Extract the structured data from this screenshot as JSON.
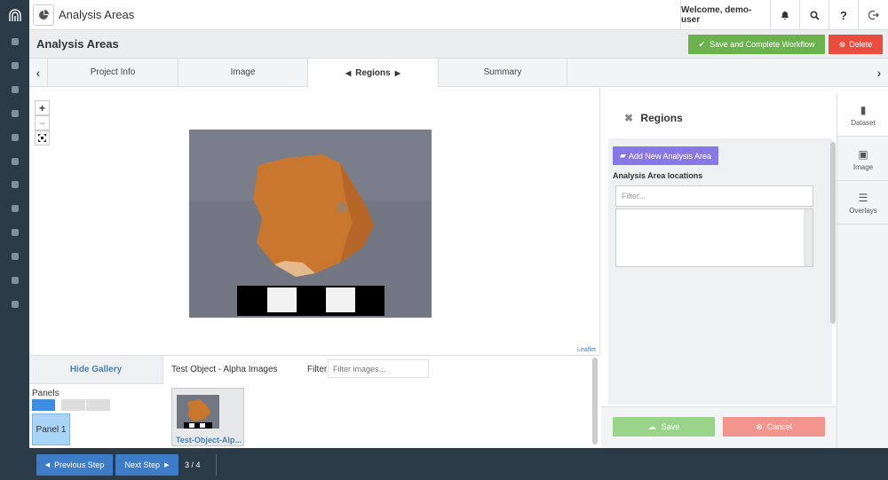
{
  "topbar": {
    "app_title": "Analysis Areas",
    "welcome": "Welcome, demo-user",
    "help": "?"
  },
  "page": {
    "title": "Analysis Areas",
    "save_complete": "Save and Complete Workflow",
    "delete": "Delete"
  },
  "tabs": [
    {
      "label": "Project Info"
    },
    {
      "label": "Image"
    },
    {
      "label": "Regions"
    },
    {
      "label": "Summary"
    }
  ],
  "map": {
    "zoom_in": "+",
    "zoom_out": "−",
    "attribution": "Leaflet"
  },
  "gallery": {
    "hide": "Hide Gallery",
    "title": "Test Object - Alpha Images",
    "filter_label": "Filter",
    "filter_placeholder": "Filter images...",
    "panels_label": "Panels",
    "panel_button": "Panel 1",
    "thumb_label": "Test-Object-Alp..."
  },
  "regions": {
    "title": "Regions",
    "add_button": "Add New Analysis Area",
    "locations_label": "Analysis Area locations",
    "filter_placeholder": "Filter...",
    "save": "Save",
    "cancel": "Cancel"
  },
  "right_tabs": [
    {
      "label": "Dataset",
      "icon": "file-icon"
    },
    {
      "label": "Image",
      "icon": "image-icon"
    },
    {
      "label": "Overlays",
      "icon": "list-icon"
    }
  ],
  "footer": {
    "prev": "Previous Step",
    "next": "Next Step",
    "step": "3 / 4"
  },
  "colors": {
    "sidebar": "#2b3a47",
    "save_green": "#6ab24c",
    "delete_red": "#ea4c3d",
    "add_purple": "#8a77e6",
    "step_blue": "#3d7cc7"
  }
}
